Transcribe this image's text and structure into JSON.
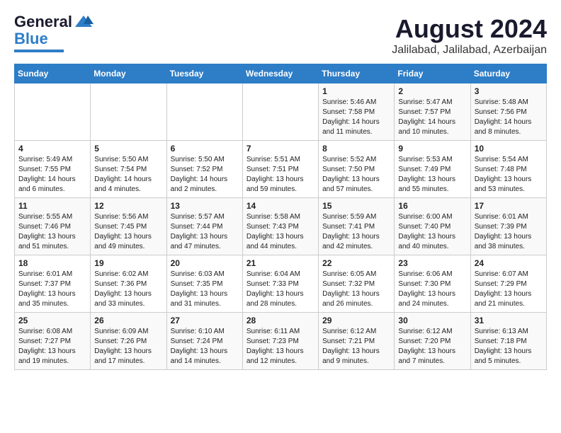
{
  "header": {
    "logo_general": "General",
    "logo_blue": "Blue",
    "month": "August 2024",
    "location": "Jalilabad, Jalilabad, Azerbaijan"
  },
  "calendar": {
    "days_of_week": [
      "Sunday",
      "Monday",
      "Tuesday",
      "Wednesday",
      "Thursday",
      "Friday",
      "Saturday"
    ],
    "weeks": [
      [
        {
          "day": "",
          "info": ""
        },
        {
          "day": "",
          "info": ""
        },
        {
          "day": "",
          "info": ""
        },
        {
          "day": "",
          "info": ""
        },
        {
          "day": "1",
          "info": "Sunrise: 5:46 AM\nSunset: 7:58 PM\nDaylight: 14 hours\nand 11 minutes."
        },
        {
          "day": "2",
          "info": "Sunrise: 5:47 AM\nSunset: 7:57 PM\nDaylight: 14 hours\nand 10 minutes."
        },
        {
          "day": "3",
          "info": "Sunrise: 5:48 AM\nSunset: 7:56 PM\nDaylight: 14 hours\nand 8 minutes."
        }
      ],
      [
        {
          "day": "4",
          "info": "Sunrise: 5:49 AM\nSunset: 7:55 PM\nDaylight: 14 hours\nand 6 minutes."
        },
        {
          "day": "5",
          "info": "Sunrise: 5:50 AM\nSunset: 7:54 PM\nDaylight: 14 hours\nand 4 minutes."
        },
        {
          "day": "6",
          "info": "Sunrise: 5:50 AM\nSunset: 7:52 PM\nDaylight: 14 hours\nand 2 minutes."
        },
        {
          "day": "7",
          "info": "Sunrise: 5:51 AM\nSunset: 7:51 PM\nDaylight: 13 hours\nand 59 minutes."
        },
        {
          "day": "8",
          "info": "Sunrise: 5:52 AM\nSunset: 7:50 PM\nDaylight: 13 hours\nand 57 minutes."
        },
        {
          "day": "9",
          "info": "Sunrise: 5:53 AM\nSunset: 7:49 PM\nDaylight: 13 hours\nand 55 minutes."
        },
        {
          "day": "10",
          "info": "Sunrise: 5:54 AM\nSunset: 7:48 PM\nDaylight: 13 hours\nand 53 minutes."
        }
      ],
      [
        {
          "day": "11",
          "info": "Sunrise: 5:55 AM\nSunset: 7:46 PM\nDaylight: 13 hours\nand 51 minutes."
        },
        {
          "day": "12",
          "info": "Sunrise: 5:56 AM\nSunset: 7:45 PM\nDaylight: 13 hours\nand 49 minutes."
        },
        {
          "day": "13",
          "info": "Sunrise: 5:57 AM\nSunset: 7:44 PM\nDaylight: 13 hours\nand 47 minutes."
        },
        {
          "day": "14",
          "info": "Sunrise: 5:58 AM\nSunset: 7:43 PM\nDaylight: 13 hours\nand 44 minutes."
        },
        {
          "day": "15",
          "info": "Sunrise: 5:59 AM\nSunset: 7:41 PM\nDaylight: 13 hours\nand 42 minutes."
        },
        {
          "day": "16",
          "info": "Sunrise: 6:00 AM\nSunset: 7:40 PM\nDaylight: 13 hours\nand 40 minutes."
        },
        {
          "day": "17",
          "info": "Sunrise: 6:01 AM\nSunset: 7:39 PM\nDaylight: 13 hours\nand 38 minutes."
        }
      ],
      [
        {
          "day": "18",
          "info": "Sunrise: 6:01 AM\nSunset: 7:37 PM\nDaylight: 13 hours\nand 35 minutes."
        },
        {
          "day": "19",
          "info": "Sunrise: 6:02 AM\nSunset: 7:36 PM\nDaylight: 13 hours\nand 33 minutes."
        },
        {
          "day": "20",
          "info": "Sunrise: 6:03 AM\nSunset: 7:35 PM\nDaylight: 13 hours\nand 31 minutes."
        },
        {
          "day": "21",
          "info": "Sunrise: 6:04 AM\nSunset: 7:33 PM\nDaylight: 13 hours\nand 28 minutes."
        },
        {
          "day": "22",
          "info": "Sunrise: 6:05 AM\nSunset: 7:32 PM\nDaylight: 13 hours\nand 26 minutes."
        },
        {
          "day": "23",
          "info": "Sunrise: 6:06 AM\nSunset: 7:30 PM\nDaylight: 13 hours\nand 24 minutes."
        },
        {
          "day": "24",
          "info": "Sunrise: 6:07 AM\nSunset: 7:29 PM\nDaylight: 13 hours\nand 21 minutes."
        }
      ],
      [
        {
          "day": "25",
          "info": "Sunrise: 6:08 AM\nSunset: 7:27 PM\nDaylight: 13 hours\nand 19 minutes."
        },
        {
          "day": "26",
          "info": "Sunrise: 6:09 AM\nSunset: 7:26 PM\nDaylight: 13 hours\nand 17 minutes."
        },
        {
          "day": "27",
          "info": "Sunrise: 6:10 AM\nSunset: 7:24 PM\nDaylight: 13 hours\nand 14 minutes."
        },
        {
          "day": "28",
          "info": "Sunrise: 6:11 AM\nSunset: 7:23 PM\nDaylight: 13 hours\nand 12 minutes."
        },
        {
          "day": "29",
          "info": "Sunrise: 6:12 AM\nSunset: 7:21 PM\nDaylight: 13 hours\nand 9 minutes."
        },
        {
          "day": "30",
          "info": "Sunrise: 6:12 AM\nSunset: 7:20 PM\nDaylight: 13 hours\nand 7 minutes."
        },
        {
          "day": "31",
          "info": "Sunrise: 6:13 AM\nSunset: 7:18 PM\nDaylight: 13 hours\nand 5 minutes."
        }
      ]
    ]
  }
}
